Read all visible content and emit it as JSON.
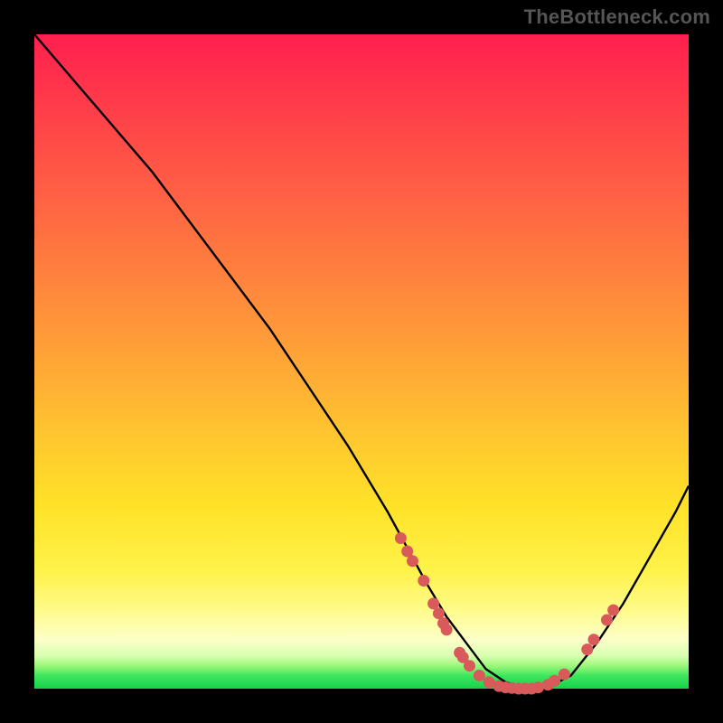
{
  "watermark": "TheBottleneck.com",
  "colors": {
    "page_bg": "#000000",
    "watermark": "#555555",
    "curve": "#000000",
    "marker_fill": "#d85a5a",
    "marker_stroke": "#b94343"
  },
  "chart_data": {
    "type": "line",
    "title": "",
    "xlabel": "",
    "ylabel": "",
    "xlim": [
      0,
      100
    ],
    "ylim": [
      0,
      100
    ],
    "grid": false,
    "legend": false,
    "series": [
      {
        "name": "bottleneck-curve",
        "x": [
          0,
          6,
          12,
          18,
          24,
          30,
          36,
          42,
          48,
          54,
          60,
          63,
          66,
          69,
          72,
          75,
          78,
          82,
          86,
          90,
          94,
          98,
          100
        ],
        "y": [
          100,
          93,
          86,
          79,
          71,
          63,
          55,
          46,
          37,
          27,
          16,
          11,
          7,
          3,
          1,
          0,
          0,
          2,
          7,
          13,
          20,
          27,
          31
        ]
      }
    ],
    "markers": [
      {
        "x": 56.0,
        "y": 23.0
      },
      {
        "x": 57.0,
        "y": 21.0
      },
      {
        "x": 57.8,
        "y": 19.5
      },
      {
        "x": 59.5,
        "y": 16.5
      },
      {
        "x": 61.0,
        "y": 13.0
      },
      {
        "x": 61.8,
        "y": 11.5
      },
      {
        "x": 62.5,
        "y": 10.0
      },
      {
        "x": 63.0,
        "y": 9.0
      },
      {
        "x": 65.0,
        "y": 5.5
      },
      {
        "x": 65.5,
        "y": 4.8
      },
      {
        "x": 66.5,
        "y": 3.5
      },
      {
        "x": 68.0,
        "y": 2.0
      },
      {
        "x": 69.5,
        "y": 1.0
      },
      {
        "x": 71.0,
        "y": 0.4
      },
      {
        "x": 72.0,
        "y": 0.2
      },
      {
        "x": 73.0,
        "y": 0.1
      },
      {
        "x": 74.0,
        "y": 0.0
      },
      {
        "x": 75.0,
        "y": 0.0
      },
      {
        "x": 76.0,
        "y": 0.0
      },
      {
        "x": 77.0,
        "y": 0.2
      },
      {
        "x": 78.5,
        "y": 0.6
      },
      {
        "x": 79.5,
        "y": 1.2
      },
      {
        "x": 81.0,
        "y": 2.2
      },
      {
        "x": 84.5,
        "y": 6.0
      },
      {
        "x": 85.5,
        "y": 7.5
      },
      {
        "x": 87.5,
        "y": 10.5
      },
      {
        "x": 88.5,
        "y": 12.0
      }
    ]
  }
}
